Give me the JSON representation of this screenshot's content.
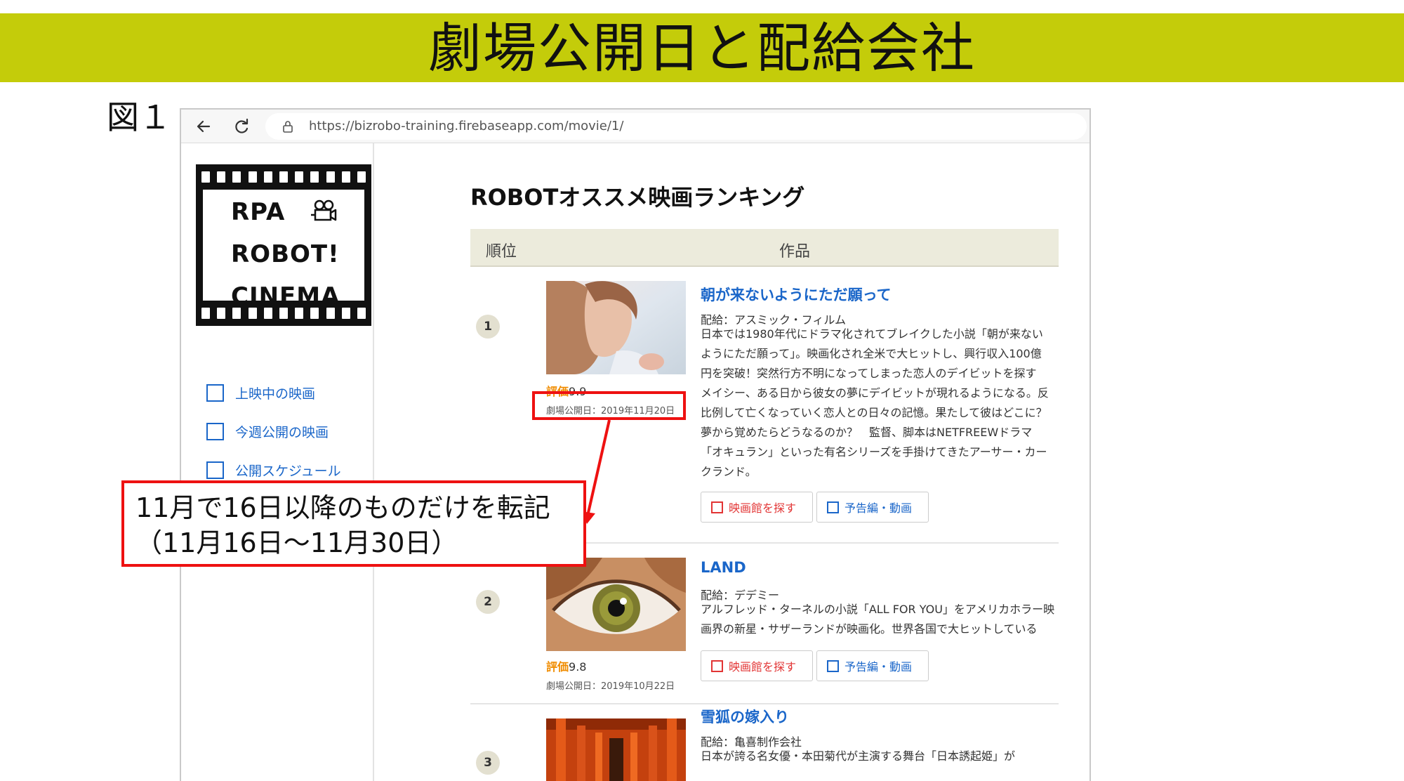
{
  "slide": {
    "title": "劇場公開日と配給会社",
    "figure_label": "図１"
  },
  "browser": {
    "url": "https://bizrobo-training.firebaseapp.com/movie/1/",
    "toolbar_icons": [
      "back-arrow-icon",
      "reload-icon",
      "lock-icon"
    ]
  },
  "sidebar": {
    "logo": {
      "line1": "RPA",
      "line2": "ROBOT!",
      "line3": "CINEMA",
      "icon": "movie-camera-icon"
    },
    "items": [
      {
        "label": "上映中の映画"
      },
      {
        "label": "今週公開の映画"
      },
      {
        "label": "公開スケジュール"
      }
    ]
  },
  "main": {
    "heading": "ROBOTオススメ映画ランキング",
    "table_headers": {
      "rank": "順位",
      "work": "作品"
    },
    "score_label": "評価",
    "buttons": {
      "theater": "映画館を探す",
      "trailer": "予告編・動画"
    },
    "movies": [
      {
        "rank": "1",
        "title": "朝が来ないようにただ願って",
        "score": "9.9",
        "release": "劇場公開日：2019年11月20日",
        "distributor": "配給：アスミック・フィルム",
        "description_lines": [
          "日本では1980年代にドラマ化されてブレイクした小説「朝が来ない",
          "ようにただ願って」。映画化され全米で大ヒットし、興行収入100億",
          "円を突破！突然行方不明になってしまった恋人のデイビットを探す",
          "メイシー、ある日から彼女の夢にデイビットが現れるようになる。反",
          "比例して亡くなっていく恋人との日々の記憶。果たして彼はどこに？",
          "夢から覚めたらどうなるのか？　監督、脚本はNETFREEWドラマ",
          "「オキュラン」といった有名シリーズを手掛けてきたアーサー・カー",
          "クランド。"
        ],
        "thumb_icon": "woman-photo-thumbnail"
      },
      {
        "rank": "2",
        "title": "LAND",
        "score": "9.8",
        "release": "劇場公開日：2019年10月22日",
        "distributor": "配給：デデミー",
        "description_lines": [
          "アルフレッド・ターネルの小説「ALL FOR YOU」をアメリカホラー映",
          "画界の新星・サザーランドが映画化。世界各国で大ヒットしている"
        ],
        "thumb_icon": "eye-photo-thumbnail"
      },
      {
        "rank": "3",
        "title": "雪狐の嫁入り",
        "distributor": "配給：亀喜制作会社",
        "description_lines": [
          "日本が誇る名女優・本田菊代が主演する舞台「日本誘起姫」が"
        ],
        "thumb_icon": "torii-gates-photo-thumbnail"
      }
    ]
  },
  "annotation": {
    "line1": "11月で16日以降のものだけを転記",
    "line2": "（11月16日～11月30日）",
    "color": "#ee1111"
  },
  "colors": {
    "title_bar": "#c4cc0a",
    "link_blue": "#1a66c9",
    "button_red": "#e23434",
    "score_orange": "#f08c00",
    "table_header_bg": "#ecebdc"
  }
}
